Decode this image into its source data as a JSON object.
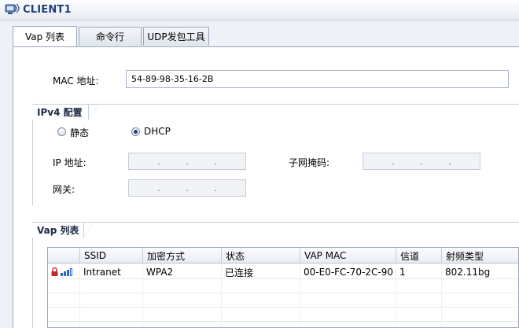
{
  "window": {
    "title": "CLIENT1"
  },
  "tabs": [
    {
      "label": "Vap 列表",
      "active": true
    },
    {
      "label": "命令行",
      "active": false
    },
    {
      "label": "UDP发包工具",
      "active": false
    }
  ],
  "mac": {
    "label": "MAC 地址:",
    "value": "54-89-98-35-16-2B"
  },
  "ipv4": {
    "section_title": "IPv4 配置",
    "static_label": "静态",
    "dhcp_label": "DHCP",
    "selected": "DHCP",
    "ip_label": "IP 地址:",
    "mask_label": "子网掩码:",
    "gateway_label": "网关:",
    "dot": "."
  },
  "vap": {
    "section_title": "Vap 列表",
    "columns": [
      "SSID",
      "加密方式",
      "状态",
      "VAP MAC",
      "信道",
      "射频类型"
    ],
    "rows": [
      {
        "ssid": "Intranet",
        "encryption": "WPA2",
        "status": "已连接",
        "vap_mac": "00-E0-FC-70-2C-90",
        "channel": "1",
        "radio_type": "802.11bg",
        "signal_bars": 3
      }
    ]
  },
  "icons": {
    "title": "client-app-icon",
    "lock": "lock-icon",
    "signal": "signal-strength-icon"
  },
  "colors": {
    "title_text": "#1f3f7a",
    "signal": "#2b67c4",
    "lock": "#c0282d"
  }
}
